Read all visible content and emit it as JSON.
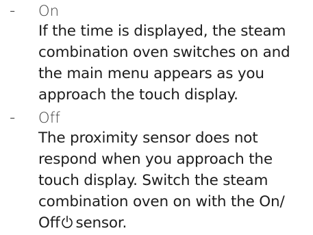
{
  "list": {
    "items": [
      {
        "bullet": "-",
        "option": "On",
        "description": "If the time is displayed, the steam combination oven switches on and the main menu appears as you approach the touch display."
      },
      {
        "bullet": "-",
        "option": "Off",
        "description_before_icon": "The proximity sensor does not respond when you approach the touch display. Switch the steam combination oven on with the On/ Off",
        "icon": "power-icon",
        "description_after_icon": "sensor."
      }
    ]
  }
}
